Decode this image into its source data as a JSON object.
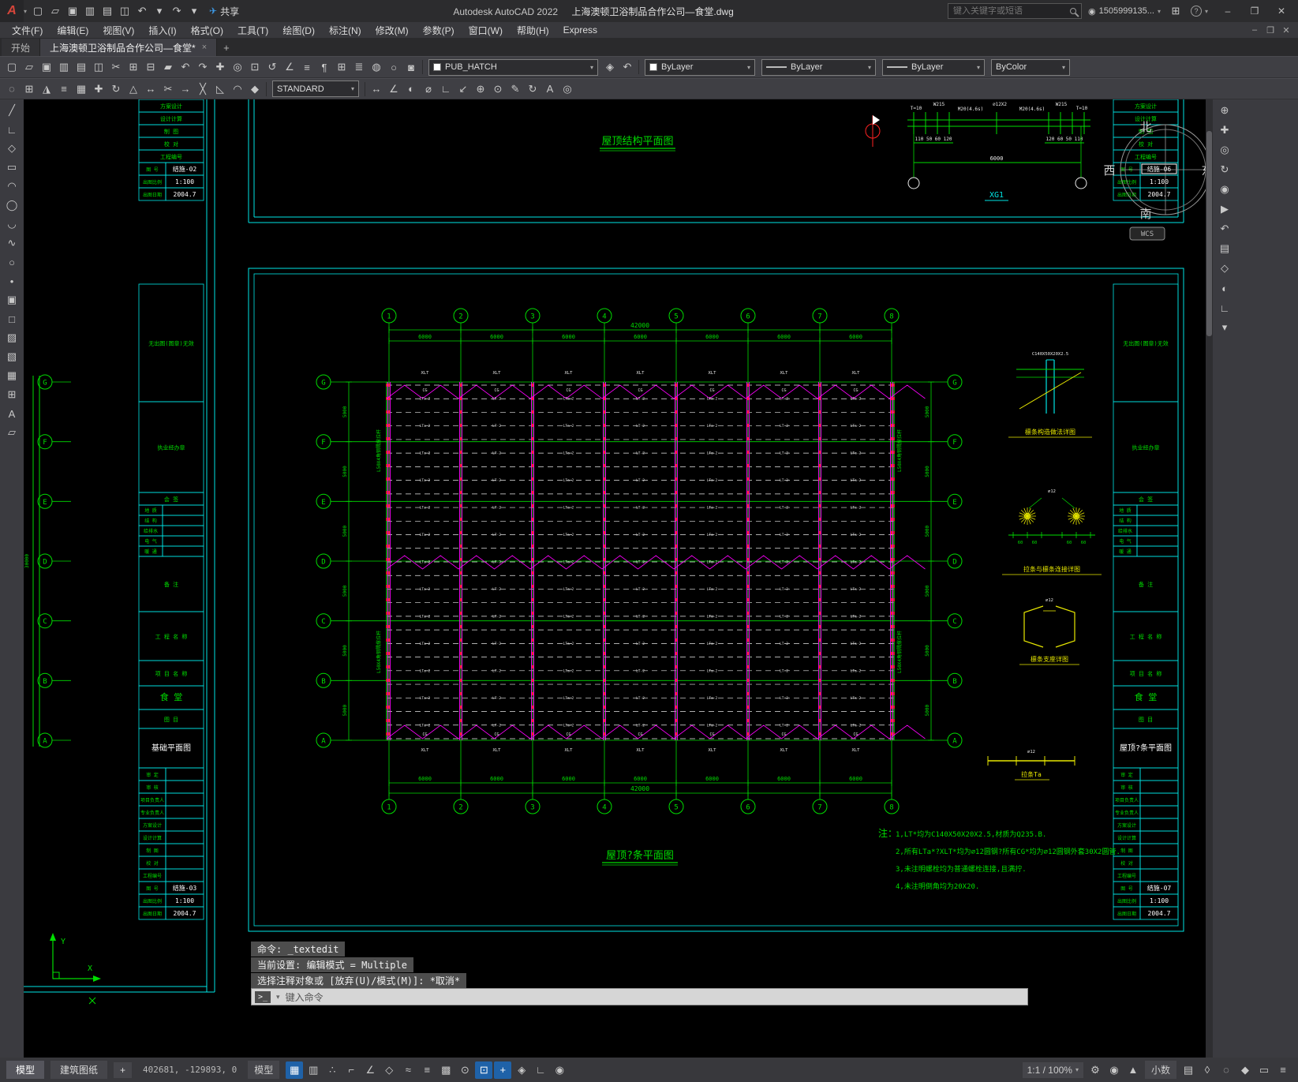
{
  "titlebar": {
    "logo": "A",
    "logo_arrow": "▾",
    "qat": [
      [
        "new",
        "▢"
      ],
      [
        "open",
        "▱"
      ],
      [
        "save",
        "▣"
      ],
      [
        "save-as",
        "▥"
      ],
      [
        "plot",
        "▤"
      ],
      [
        "plot-preview",
        "◫"
      ],
      [
        "undo",
        "↶"
      ],
      [
        "undo-arrow",
        "▾"
      ],
      [
        "redo",
        "↷"
      ],
      [
        "redo-arrow",
        "▾"
      ]
    ],
    "share_icon": "✈",
    "share_label": "共享",
    "app_title": "Autodesk AutoCAD 2022",
    "doc_title": "上海澳顿卫浴制品合作公司—食堂.dwg",
    "search_placeholder": "键入关键字或短语",
    "account_icon": "◉",
    "account": "1505999135...",
    "account_arrow": "▾",
    "cart_icon": "⊞",
    "help": "?",
    "help_arrow": "▾",
    "win": {
      "min": "–",
      "max": "❐",
      "close": "✕"
    }
  },
  "menubar": {
    "items": [
      "文件(F)",
      "编辑(E)",
      "视图(V)",
      "插入(I)",
      "格式(O)",
      "工具(T)",
      "绘图(D)",
      "标注(N)",
      "修改(M)",
      "参数(P)",
      "窗口(W)",
      "帮助(H)",
      "Express"
    ],
    "doc_controls": [
      "–",
      "❐",
      "✕"
    ]
  },
  "filetabs": {
    "start": "开始",
    "doc": "上海澳顿卫浴制品合作公司—食堂*",
    "close_glyph": "×",
    "add_glyph": "+"
  },
  "toolbars": {
    "row1_icons": [
      [
        "qnew",
        "▢"
      ],
      [
        "open",
        "▱"
      ],
      [
        "save",
        "▣"
      ],
      [
        "save-as",
        "▥"
      ],
      [
        "plot",
        "▤"
      ],
      [
        "plot-preview",
        "◫"
      ],
      [
        "cut",
        "✂"
      ],
      [
        "copy-clip",
        "⊞"
      ],
      [
        "paste",
        "⊟"
      ],
      [
        "match-properties",
        "▰"
      ],
      [
        "undo",
        "↶"
      ],
      [
        "redo",
        "↷"
      ],
      [
        "pan-realtime",
        "✚"
      ],
      [
        "zoom-realtime",
        "◎"
      ],
      [
        "zoom-window",
        "⊡"
      ],
      [
        "zoom-previous",
        "↺"
      ],
      [
        "measure",
        "∠"
      ],
      [
        "quick-calc",
        "≡"
      ],
      [
        "field",
        "¶"
      ],
      [
        "table",
        "⊞"
      ],
      [
        "layer-properties",
        "≣"
      ],
      [
        "layer-states",
        "◍"
      ],
      [
        "layer-off",
        "○"
      ],
      [
        "layer-lock",
        "◙"
      ]
    ],
    "layer_value": "PUB_HATCH",
    "row1_icons_b": [
      [
        "make-object-layer-current",
        "◈"
      ],
      [
        "layer-previous",
        "↶"
      ]
    ],
    "color_value": "ByLayer",
    "linetype_value": "ByLayer",
    "lineweight_value": "ByLayer",
    "plotstyle_value": "ByColor",
    "row2_icons_a": [
      [
        "erase",
        "◌"
      ],
      [
        "copy",
        "⊞"
      ],
      [
        "mirror",
        "◮"
      ],
      [
        "offset",
        "≡"
      ],
      [
        "array",
        "▦"
      ],
      [
        "move",
        "✚"
      ],
      [
        "rotate",
        "↻"
      ],
      [
        "scale",
        "△"
      ],
      [
        "stretch",
        "↔"
      ],
      [
        "trim",
        "✂"
      ],
      [
        "extend",
        "→"
      ],
      [
        "break",
        "╳"
      ],
      [
        "chamfer",
        "◺"
      ],
      [
        "fillet",
        "◠"
      ],
      [
        "explode",
        "◆"
      ]
    ],
    "style_value": "STANDARD",
    "row2_icons_b": [
      [
        "dim-linear",
        "↔"
      ],
      [
        "dim-aligned",
        "∠"
      ],
      [
        "dim-radius",
        "◐"
      ],
      [
        "dim-diameter",
        "⌀"
      ],
      [
        "dim-angular",
        "∟"
      ],
      [
        "quick-leader",
        "↙"
      ],
      [
        "tolerance",
        "⊕"
      ],
      [
        "center-mark",
        "⊙"
      ],
      [
        "dim-edit",
        "✎"
      ],
      [
        "dim-update",
        "↻"
      ],
      [
        "multiline-text",
        "A"
      ],
      [
        "find-replace",
        "◎"
      ]
    ]
  },
  "left_palette": [
    [
      "line",
      "╱"
    ],
    [
      "polyline",
      "∟"
    ],
    [
      "polygon",
      "◇"
    ],
    [
      "rectangle",
      "▭"
    ],
    [
      "arc",
      "◠"
    ],
    [
      "circle",
      "◯"
    ],
    [
      "revision-cloud",
      "◡"
    ],
    [
      "spline",
      "∿"
    ],
    [
      "ellipse",
      "○"
    ],
    [
      "point",
      "•"
    ],
    [
      "insert-block",
      "▣"
    ],
    [
      "make-block",
      "□"
    ],
    [
      "hatch",
      "▨"
    ],
    [
      "gradient",
      "▧"
    ],
    [
      "region",
      "▦"
    ],
    [
      "table",
      "⊞"
    ],
    [
      "multiline-text",
      "A"
    ],
    [
      "wipeout",
      "▱"
    ]
  ],
  "right_palette": [
    [
      "full-navigation",
      "⊕"
    ],
    [
      "pan",
      "✚"
    ],
    [
      "zoom-extents",
      "◎"
    ],
    [
      "orbit",
      "↻"
    ],
    [
      "steering-wheel",
      "◉"
    ],
    [
      "show-motion",
      "▶"
    ],
    [
      "previous-view",
      "↶"
    ],
    [
      "named-views",
      "▤"
    ],
    [
      "3d-view",
      "◇"
    ],
    [
      "camera",
      "◐"
    ],
    [
      "ucs-icon-toggle",
      "∟"
    ],
    [
      "nav-settings",
      "▾"
    ]
  ],
  "commandline": {
    "history": [
      "命令: _textedit",
      "当前设置: 编辑模式 = Multiple",
      "选择注释对象或 [放弃(U)/模式(M)]: *取消*"
    ],
    "icon": ">_",
    "arrow": "▾",
    "prompt": "键入命令"
  },
  "statusbar": {
    "tabs": [
      "模型",
      "建筑图纸"
    ],
    "add_label": "+",
    "coords": "402681, -129893, 0",
    "model_label": "模型",
    "icons": [
      [
        "grid",
        "▦",
        1
      ],
      [
        "snap",
        "▥",
        0
      ],
      [
        "infer-constraints",
        "∴",
        0
      ],
      [
        "ortho",
        "⌐",
        0
      ],
      [
        "polar-tracking",
        "∠",
        0
      ],
      [
        "isodraft",
        "◇",
        0
      ],
      [
        "object-snap-tracking",
        "≈",
        0
      ],
      [
        "lineweight-display",
        "≡",
        0
      ],
      [
        "transparency",
        "▩",
        0
      ],
      [
        "selection-cycling",
        "⊙",
        0
      ],
      [
        "object-snap",
        "⊡",
        1
      ],
      [
        "dynamic-input",
        "+",
        1
      ],
      [
        "3d-object-snap",
        "◈",
        0
      ],
      [
        "dynamic-ucs",
        "∟",
        0
      ],
      [
        "annotation-monitor",
        "◉",
        0
      ]
    ],
    "scale": "1:1 / 100%",
    "scale_arrow": "▾",
    "icons2": [
      [
        "workspace-switching",
        "⚙",
        0
      ],
      [
        "annotation-visibility",
        "◉",
        0
      ],
      [
        "autoscale",
        "▲",
        0
      ]
    ],
    "units": "小数",
    "icons3": [
      [
        "quick-properties",
        "▤",
        0
      ],
      [
        "lock-ui",
        "◊",
        0
      ],
      [
        "isolate-objects",
        "◌",
        0
      ],
      [
        "graphics-performance",
        "◆",
        0
      ],
      [
        "clean-screen",
        "▭",
        0
      ],
      [
        "customize",
        "≡",
        0
      ]
    ]
  },
  "drawing": {
    "sheet_top": {
      "title": "屋顶结构平面图",
      "ann_t": "T=10",
      "ann_w": "W215",
      "ann_m": "M20(4.6s)",
      "ann_rod": "∅12X2",
      "dims_l": "110  50 60 120",
      "dims_r": "120 60 50  110",
      "dim_span": "6000",
      "mark": "XG1"
    },
    "main": {
      "title": "屋顶?条平面图",
      "axis_cols": [
        "1",
        "2",
        "3",
        "4",
        "5",
        "6",
        "7",
        "8"
      ],
      "axis_rows": [
        "G",
        "F",
        "E",
        "D",
        "C",
        "B",
        "A"
      ],
      "dim_total_h": "42000",
      "dim_bay": "6000",
      "dim_row": "5000",
      "dim_total_v": "30000",
      "purlin_label": "LT-2",
      "purlin_label_alt": "LTa-2",
      "tie_label": "CG",
      "brace_label": "XLT",
      "angle_note": "L50X4角钢隅撑拉杆"
    },
    "notes": {
      "head": "注：",
      "lines": [
        "1,LT*均为C140X50X20X2.5,材质为Q235.B.",
        "2,所有LTa*?XLT*均为∅12圆钢?所有CG*均为∅12圆钢外套30X2圆管.",
        "3,未注明螺栓均为普通螺栓连接,且满拧.",
        "4,未注明倒角均为20X20."
      ]
    },
    "details": [
      {
        "label": "檩条构造做法详图",
        "note": "C140X50X20X2.5"
      },
      {
        "label": "拉条与檩条连接详图",
        "note": "∅12",
        "dim_val": "60"
      },
      {
        "label": "檩条支座详图",
        "note": "∅12"
      },
      {
        "label": "拉条Ta",
        "note": "∅12"
      }
    ],
    "titleblock": {
      "rows_small": [
        "方案设计",
        "设计计算",
        "制  图",
        "校  对",
        "工程编号"
      ],
      "sheet_no_label": "图  号",
      "scale_label": "出图比例",
      "date_label": "出图日期",
      "scale": "1:100",
      "date": "2004.7",
      "sheets": {
        "left_top": "结施-02",
        "left_main": "结施-03",
        "right_top": "结施-06",
        "right_main": "结施-07"
      },
      "stamp1": "无出图(图章)无效",
      "stamp2": "执业经办章",
      "sign_head": "会  签",
      "sign_rows": [
        "地  质",
        "结  构",
        "给排水",
        "电  气",
        "暖  通"
      ],
      "remark": "备  注",
      "project_label": "工 程 名 称",
      "item_label": "项 目 名 称",
      "project_name": "食  堂",
      "fig_label": "图  目",
      "fig_left": "基础平面图",
      "fig_right": "屋顶?条平面图",
      "approve_rows": [
        "审  定",
        "审  核",
        "项目负责人",
        "专业负责人",
        "方案设计",
        "设计计算",
        "制  图",
        "校  对",
        "工程编号"
      ]
    },
    "compass": {
      "n": "北",
      "w": "西",
      "e": "东",
      "s": "南"
    },
    "wcs": "WCS",
    "ucs": {
      "x": "X",
      "y": "Y"
    }
  }
}
